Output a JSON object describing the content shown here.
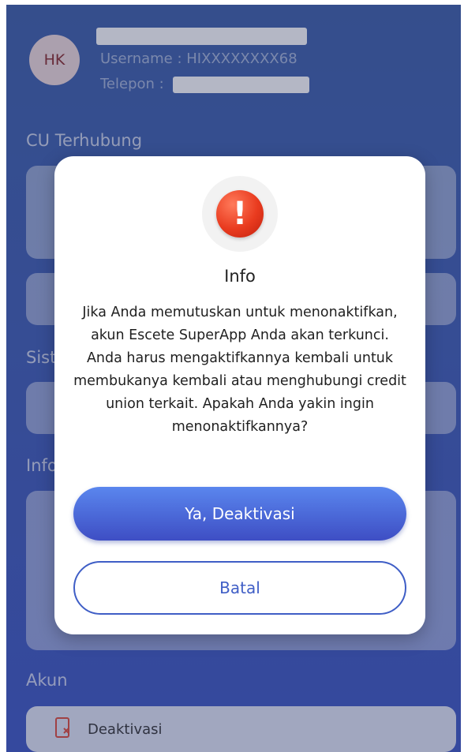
{
  "profile": {
    "initials": "HK",
    "username_line": "Username : HIXXXXXXXX68",
    "phone_label": "Telepon :"
  },
  "sections": {
    "cu": "CU Terhubung",
    "system": "Sist",
    "info": "Info",
    "account": "Akun"
  },
  "account_items": [
    {
      "label": "Deaktivasi",
      "icon": "phone-x-icon"
    }
  ],
  "dialog": {
    "icon": "alert-icon",
    "title": "Info",
    "message": "Jika Anda memutuskan untuk menonaktifkan, akun Escete SuperApp Anda akan terkunci. Anda harus mengaktifkannya kembali untuk membukanya kembali atau menghubungi credit union terkait. Apakah Anda yakin ingin menonaktifkannya?",
    "confirm_label": "Ya, Deaktivasi",
    "cancel_label": "Batal"
  },
  "colors": {
    "primary": "#3f5ec6",
    "alert": "#e93b1f"
  }
}
